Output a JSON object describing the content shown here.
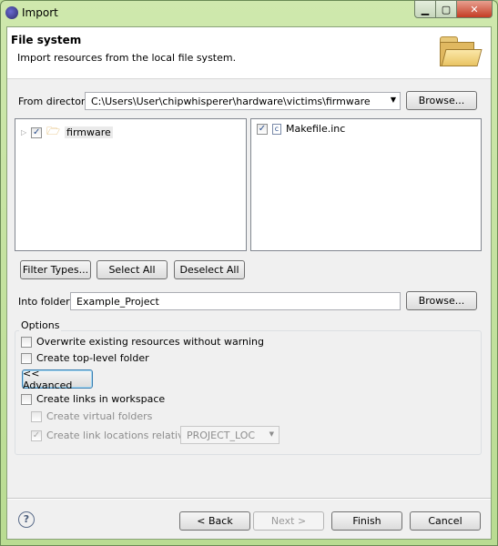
{
  "window": {
    "title": "Import",
    "controls": [
      "minimize",
      "maximize",
      "close"
    ]
  },
  "header": {
    "title": "File system",
    "subtitle": "Import resources from the local file system.",
    "icon": "folder-open-icon"
  },
  "from_directory": {
    "label": "From directory:",
    "value": "C:\\Users\\User\\chipwhisperer\\hardware\\victims\\firmware",
    "browse": "Browse..."
  },
  "tree": [
    {
      "label": "firmware",
      "checked": true,
      "expanded": false
    }
  ],
  "files": [
    {
      "label": "Makefile.inc",
      "checked": true
    }
  ],
  "selection_buttons": {
    "filter": "Filter Types...",
    "select_all": "Select All",
    "deselect_all": "Deselect All"
  },
  "into_folder": {
    "label": "Into folder:",
    "value": "Example_Project",
    "browse": "Browse..."
  },
  "options": {
    "label": "Options",
    "overwrite": {
      "label": "Overwrite existing resources without warning",
      "checked": false
    },
    "top_level": {
      "label": "Create top-level folder",
      "checked": false
    },
    "advanced": "<< Advanced",
    "links": {
      "label": "Create links in workspace",
      "checked": false
    },
    "virtual": {
      "label": "Create virtual folders",
      "checked": false,
      "enabled": false
    },
    "relative": {
      "label": "Create link locations relative to:",
      "checked": true,
      "enabled": false,
      "value": "PROJECT_LOC"
    }
  },
  "footer": {
    "back": "< Back",
    "next": "Next >",
    "finish": "Finish",
    "cancel": "Cancel",
    "help_icon": "help-icon"
  }
}
